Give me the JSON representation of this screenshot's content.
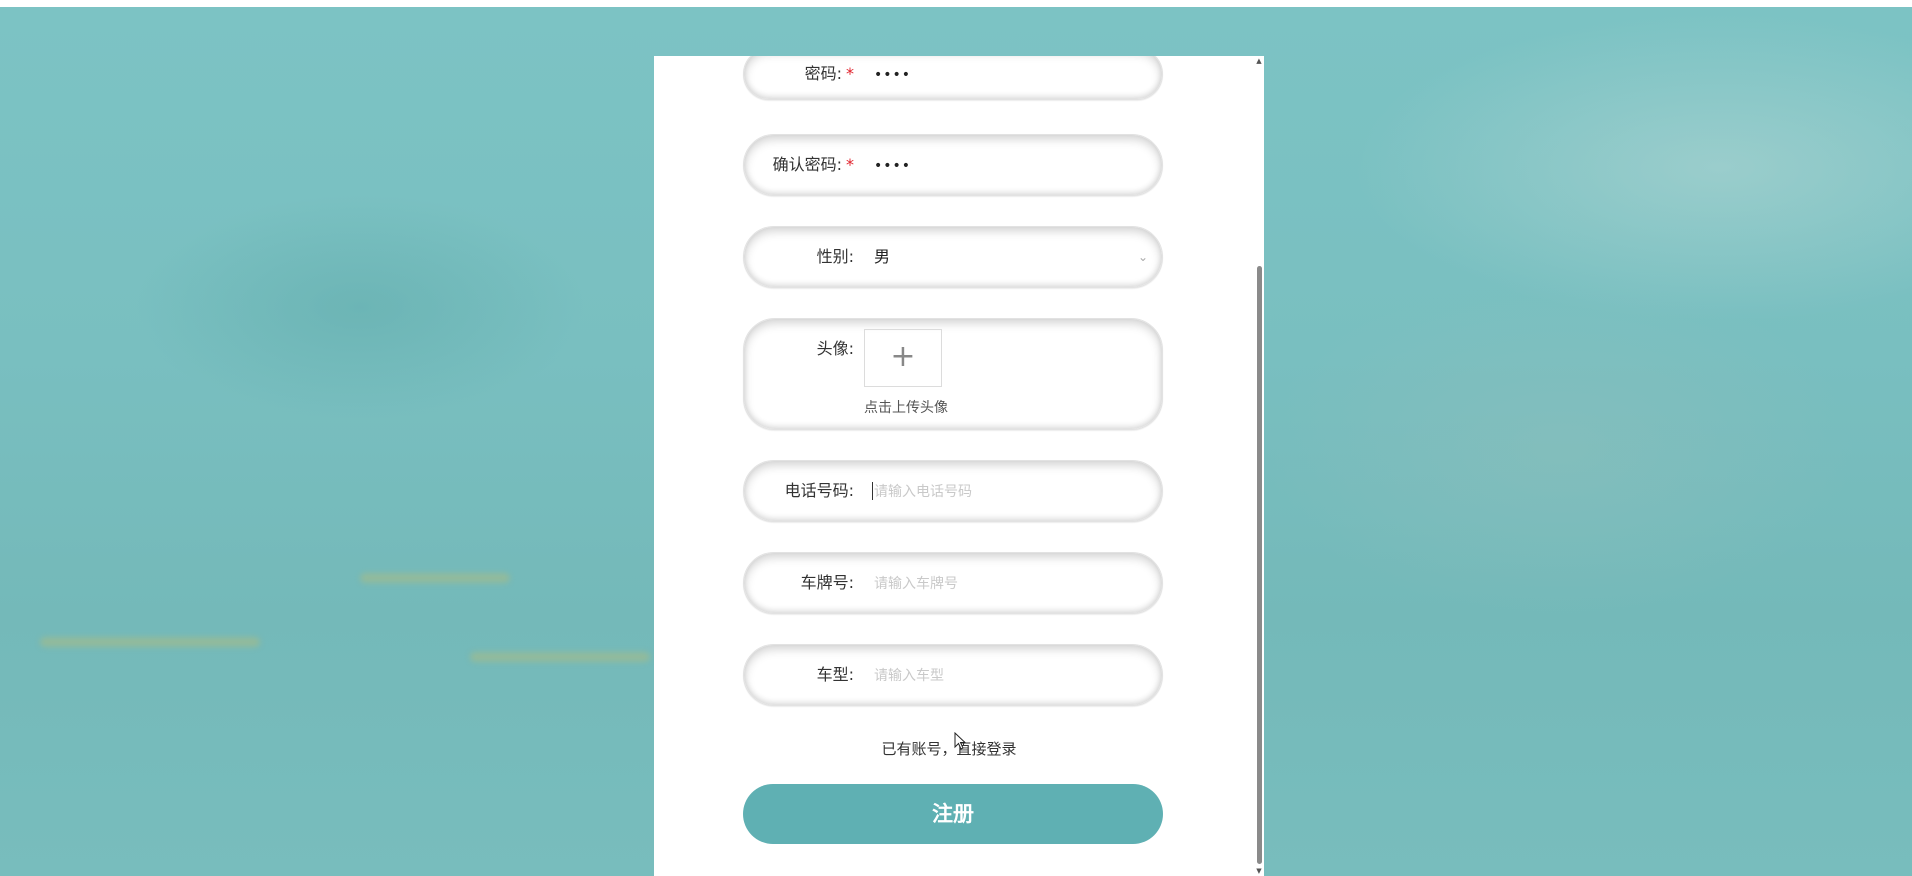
{
  "form": {
    "password": {
      "label": "密码:",
      "required_mark": "*",
      "value": "••••"
    },
    "confirm_password": {
      "label": "确认密码:",
      "required_mark": "*",
      "value": "••••"
    },
    "gender": {
      "label": "性别:",
      "value": "男"
    },
    "avatar": {
      "label": "头像:",
      "upload_icon": "plus-icon",
      "upload_glyph": "+",
      "caption": "点击上传头像"
    },
    "phone": {
      "label": "电话号码:",
      "placeholder": "请输入电话号码"
    },
    "plate": {
      "label": "车牌号:",
      "placeholder": "请输入车牌号"
    },
    "car_type": {
      "label": "车型:",
      "placeholder": "请输入车型"
    },
    "login_link": "已有账号，直接登录",
    "register_button": "注册"
  },
  "colors": {
    "accent": "#5fb0b3",
    "backdrop": "#7cc3c4",
    "required": "#e0202a"
  }
}
